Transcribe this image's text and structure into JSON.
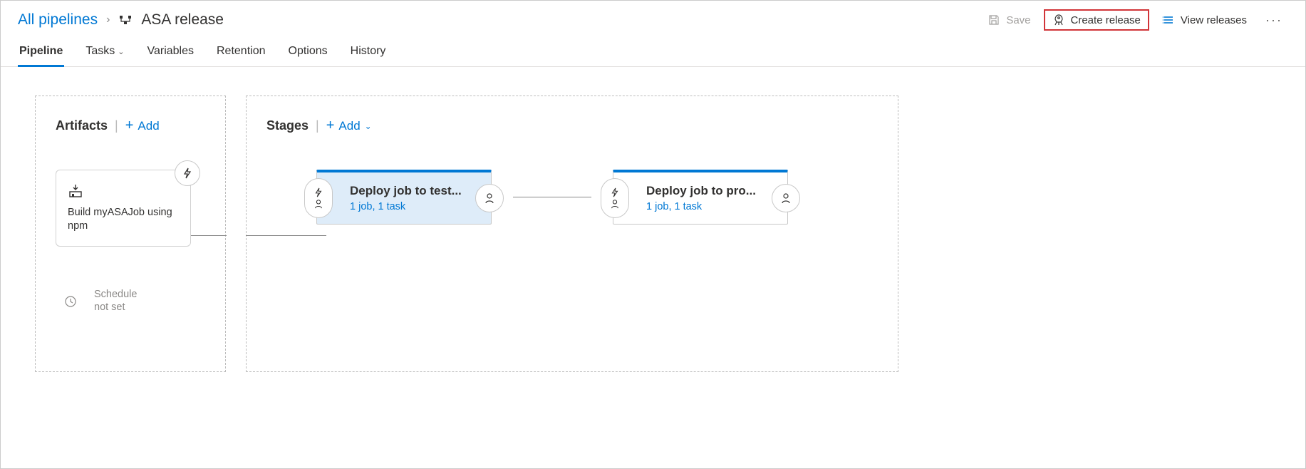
{
  "breadcrumb": {
    "root": "All pipelines",
    "title": "ASA release"
  },
  "actions": {
    "save": "Save",
    "create_release": "Create release",
    "view_releases": "View releases"
  },
  "tabs": {
    "pipeline": "Pipeline",
    "tasks": "Tasks",
    "variables": "Variables",
    "retention": "Retention",
    "options": "Options",
    "history": "History"
  },
  "artifacts": {
    "title": "Artifacts",
    "add": "Add",
    "card_name": "Build myASAJob using npm",
    "schedule_label": "Schedule\nnot set"
  },
  "stages": {
    "title": "Stages",
    "add": "Add",
    "items": [
      {
        "name": "Deploy job to test...",
        "sub": "1 job, 1 task"
      },
      {
        "name": "Deploy job to pro...",
        "sub": "1 job, 1 task"
      }
    ]
  }
}
